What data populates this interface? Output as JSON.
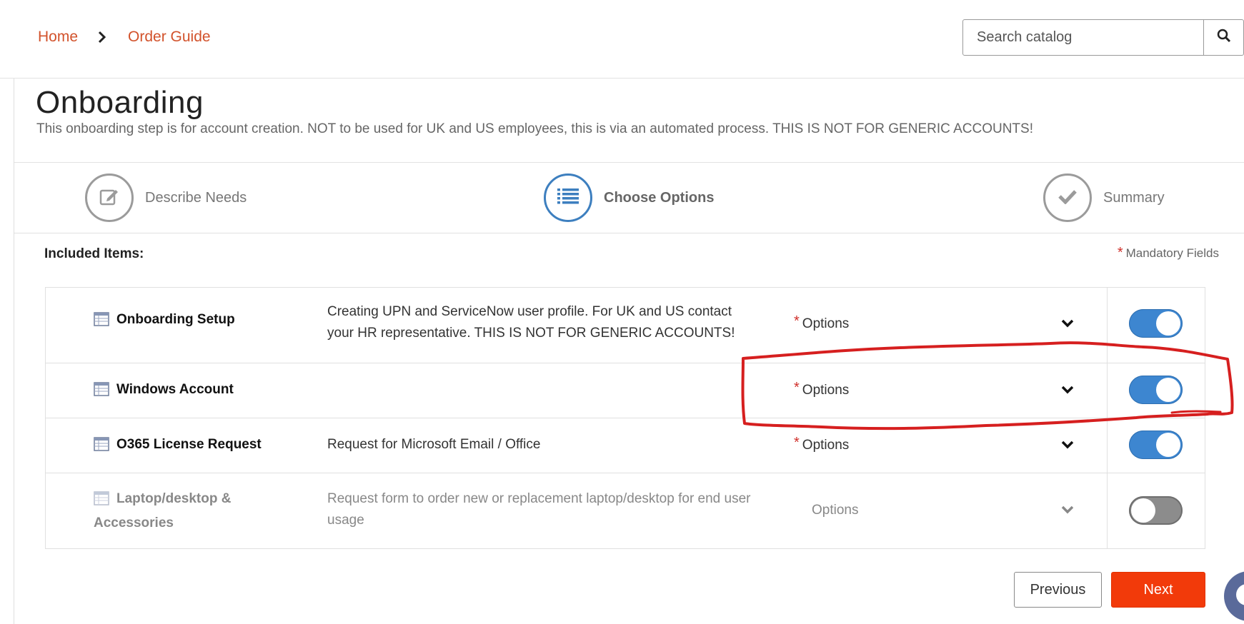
{
  "breadcrumb": {
    "home": "Home",
    "current": "Order Guide"
  },
  "search": {
    "placeholder": "Search catalog",
    "icon": "search-icon"
  },
  "page": {
    "title": "Onboarding",
    "description": "This onboarding step is for account creation. NOT to be used for UK and US employees, this is via an automated process. THIS IS NOT FOR GENERIC ACCOUNTS!"
  },
  "stepper": {
    "steps": [
      {
        "label": "Describe Needs",
        "icon": "edit-icon",
        "active": false
      },
      {
        "label": "Choose Options",
        "icon": "list-icon",
        "active": true
      },
      {
        "label": "Summary",
        "icon": "check-icon",
        "active": false
      }
    ]
  },
  "included": {
    "label": "Included Items:",
    "mandatory_star": "*",
    "mandatory_label": "Mandatory Fields",
    "items": [
      {
        "name": "Onboarding Setup",
        "description": "Creating UPN and ServiceNow user profile. For UK and US contact your HR representative. THIS IS NOT FOR GENERIC ACCOUNTS!",
        "options_required": "*",
        "options_label": "Options",
        "enabled": true
      },
      {
        "name": "Windows Account",
        "description": "",
        "options_required": "*",
        "options_label": "Options",
        "enabled": true
      },
      {
        "name": "O365 License Request",
        "description": "Request for Microsoft Email / Office",
        "options_required": "*",
        "options_label": "Options",
        "enabled": true
      },
      {
        "name": "Laptop/desktop & Accessories",
        "description": "Request form to order new or replacement laptop/desktop for end user usage",
        "options_required": "",
        "options_label": "Options",
        "enabled": false
      }
    ]
  },
  "buttons": {
    "previous": "Previous",
    "next": "Next"
  },
  "colors": {
    "breadcrumb": "#d2522b",
    "accent": "#3d86d0",
    "next_button": "#f23a0a",
    "required": "#d0302b",
    "annotation": "#d61f1f"
  }
}
